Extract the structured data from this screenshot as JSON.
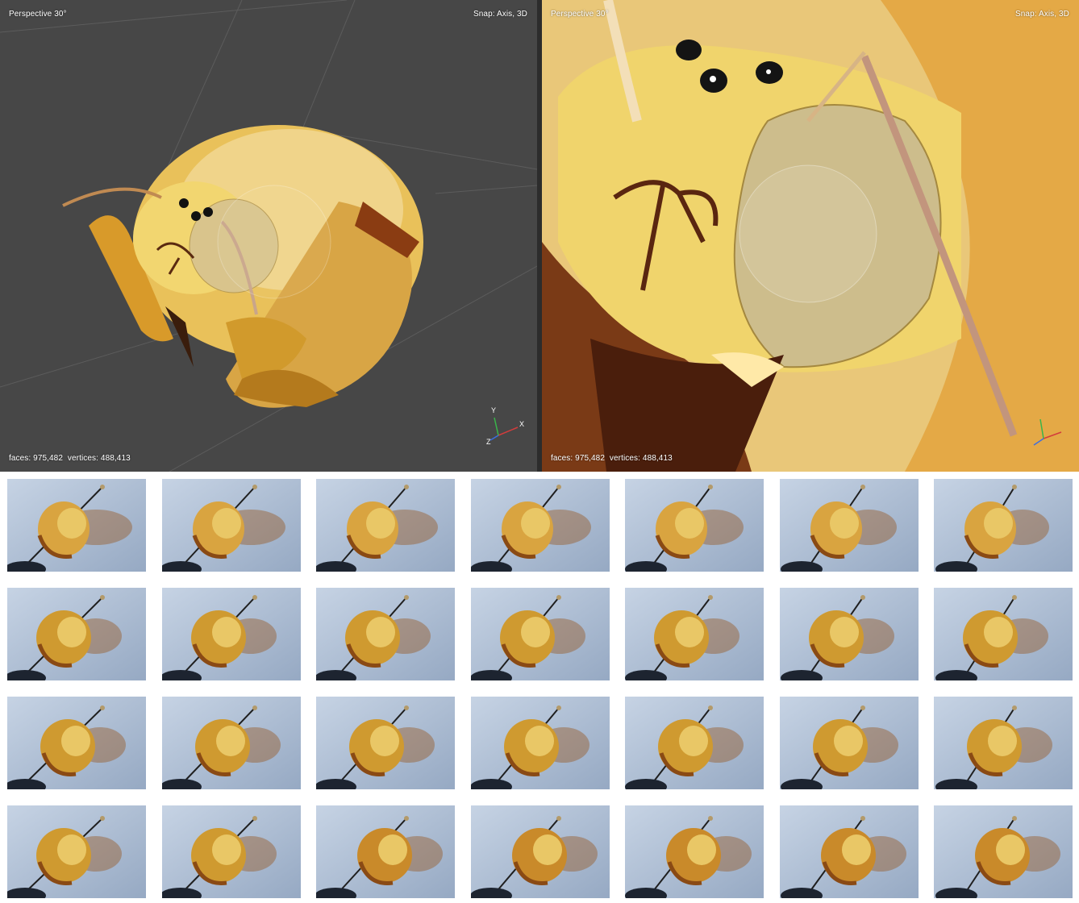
{
  "viewports": [
    {
      "id": "left",
      "camera_label": "Perspective 30°",
      "snap_label": "Snap: Axis, 3D",
      "stats": {
        "faces": "faces: 975,482",
        "vertices": "vertices: 488,413"
      },
      "axes": {
        "x": "X",
        "y": "Y",
        "z": "Z"
      }
    },
    {
      "id": "right",
      "camera_label": "Perspective 30°",
      "snap_label": "Snap: Axis, 3D",
      "stats": {
        "faces": "faces: 975,482",
        "vertices": "vertices: 488,413"
      },
      "axes": {
        "x": "X",
        "y": "Y",
        "z": "Z"
      }
    }
  ],
  "photo_strip": {
    "rows": 4,
    "columns": 7,
    "count": 28,
    "subject_icon": "bee-specimen-photo",
    "background_color": "#aebfd6"
  },
  "colors": {
    "viewport_bg": "#474747",
    "bee_gold": "#e0a838",
    "bee_yellow": "#f1d66a",
    "axis_x": "#d33c3c",
    "axis_y": "#39b54a",
    "axis_z": "#3c6ee0"
  }
}
